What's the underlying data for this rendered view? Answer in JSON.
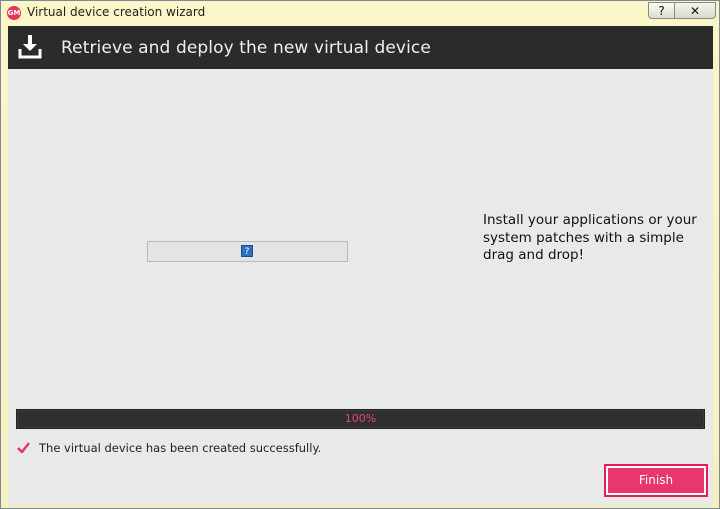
{
  "window": {
    "title": "Virtual device creation wizard",
    "app_icon": "genymotion-logo-icon",
    "help_label": "?",
    "close_label": "✕"
  },
  "header": {
    "title": "Retrieve and deploy the new virtual device",
    "icon": "download-icon"
  },
  "main": {
    "image_placeholder_icon": "missing-image-icon",
    "info_text": "Install your applications or your system patches with a simple drag and drop!"
  },
  "progress": {
    "value": 1.0,
    "label": "100%"
  },
  "status": {
    "icon": "checkmark-icon",
    "text": "The virtual device has been created successfully."
  },
  "footer": {
    "finish_label": "Finish"
  },
  "colors": {
    "accent": "#e8376a",
    "header_bg": "#2b2b2b",
    "content_bg": "#e9e9e9"
  }
}
